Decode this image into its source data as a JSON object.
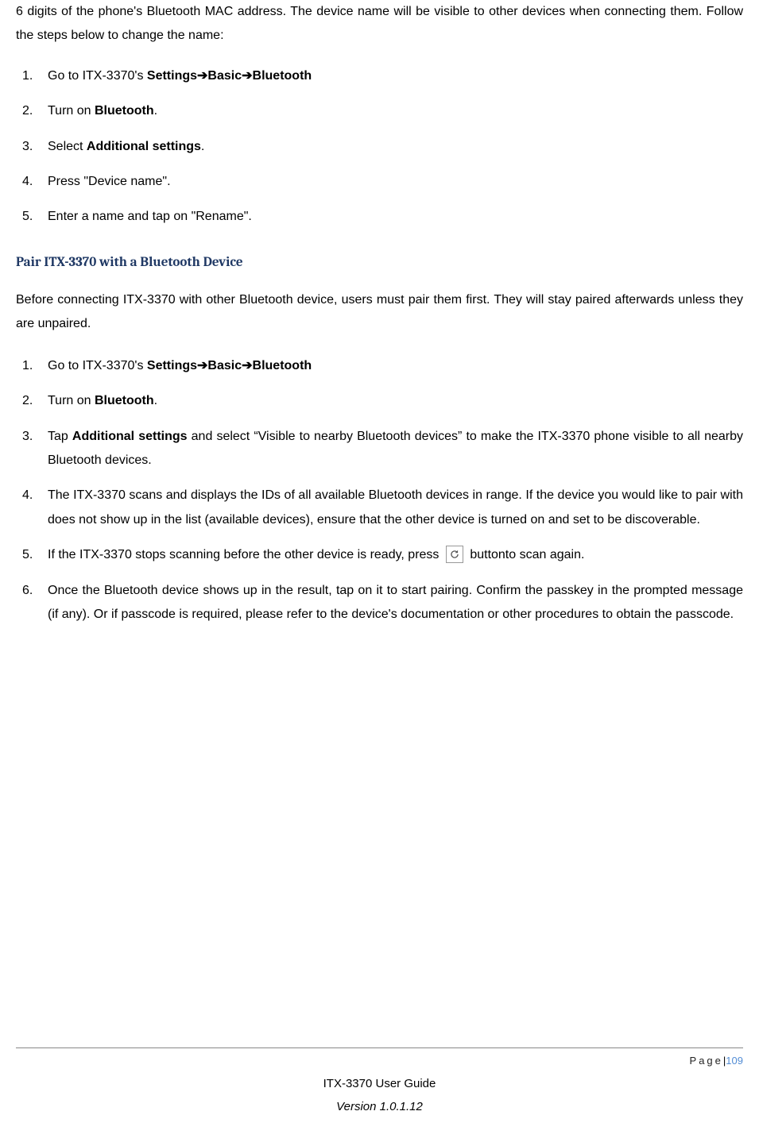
{
  "intro": {
    "line1_pre": "6 digits of the phone's Bluetooth MAC address. The device name will be visible to other devices when",
    "line2": "connecting them. Follow the steps below to change the name:"
  },
  "list1": {
    "n1": "1.",
    "i1_pre": "Go to ITX-3370's ",
    "i1_b1": "Settings",
    "arrow": "➔",
    "i1_b2": "Basic",
    "i1_b3": "Bluetooth",
    "n2": "2.",
    "i2_pre": "Turn on ",
    "i2_b": "Bluetooth",
    "i2_post": ".",
    "n3": "3.",
    "i3_pre": "Select ",
    "i3_b": "Additional settings",
    "i3_post": ".",
    "n4": "4.",
    "i4": "Press \"Device name\".",
    "n5": "5.",
    "i5": "Enter a name and tap on \"Rename\"."
  },
  "heading1": "Pair ITX-3370 with a Bluetooth Device",
  "para1": "Before connecting ITX-3370 with other Bluetooth device, users must pair them first. They will stay paired afterwards unless they are unpaired.",
  "list2": {
    "n1": "1.",
    "i1_pre": "Go to ITX-3370's ",
    "i1_b1": "Settings",
    "i1_b2": "Basic",
    "i1_b3": "Bluetooth",
    "n2": "2.",
    "i2_pre": "Turn on ",
    "i2_b": "Bluetooth",
    "i2_post": ".",
    "n3": "3.",
    "i3_pre": "Tap ",
    "i3_b": "Additional settings",
    "i3_post": " and select “Visible to nearby Bluetooth devices” to make the ITX-3370 phone visible to all nearby Bluetooth devices.",
    "n4": "4.",
    "i4": "The ITX-3370 scans and displays the IDs of all available Bluetooth devices in range. If the device you would like to pair with does not show up in the list (available devices), ensure that the other device is turned on and set to be discoverable.",
    "n5": "5.",
    "i5_pre": "If the ITX-3370 stops scanning before the other device is ready, press ",
    "i5_post": " buttonto scan again.",
    "n6": "6.",
    "i6": "Once the Bluetooth device shows up in the result, tap on it to start pairing. Confirm the passkey in the prompted message (if any). Or if passcode is required, please refer to the device's documentation or other procedures to obtain the passcode."
  },
  "footer": {
    "page_label": "Page",
    "sep": " | ",
    "page_num": "109",
    "title": "ITX-3370 User Guide",
    "version": "Version 1.0.1.12"
  }
}
